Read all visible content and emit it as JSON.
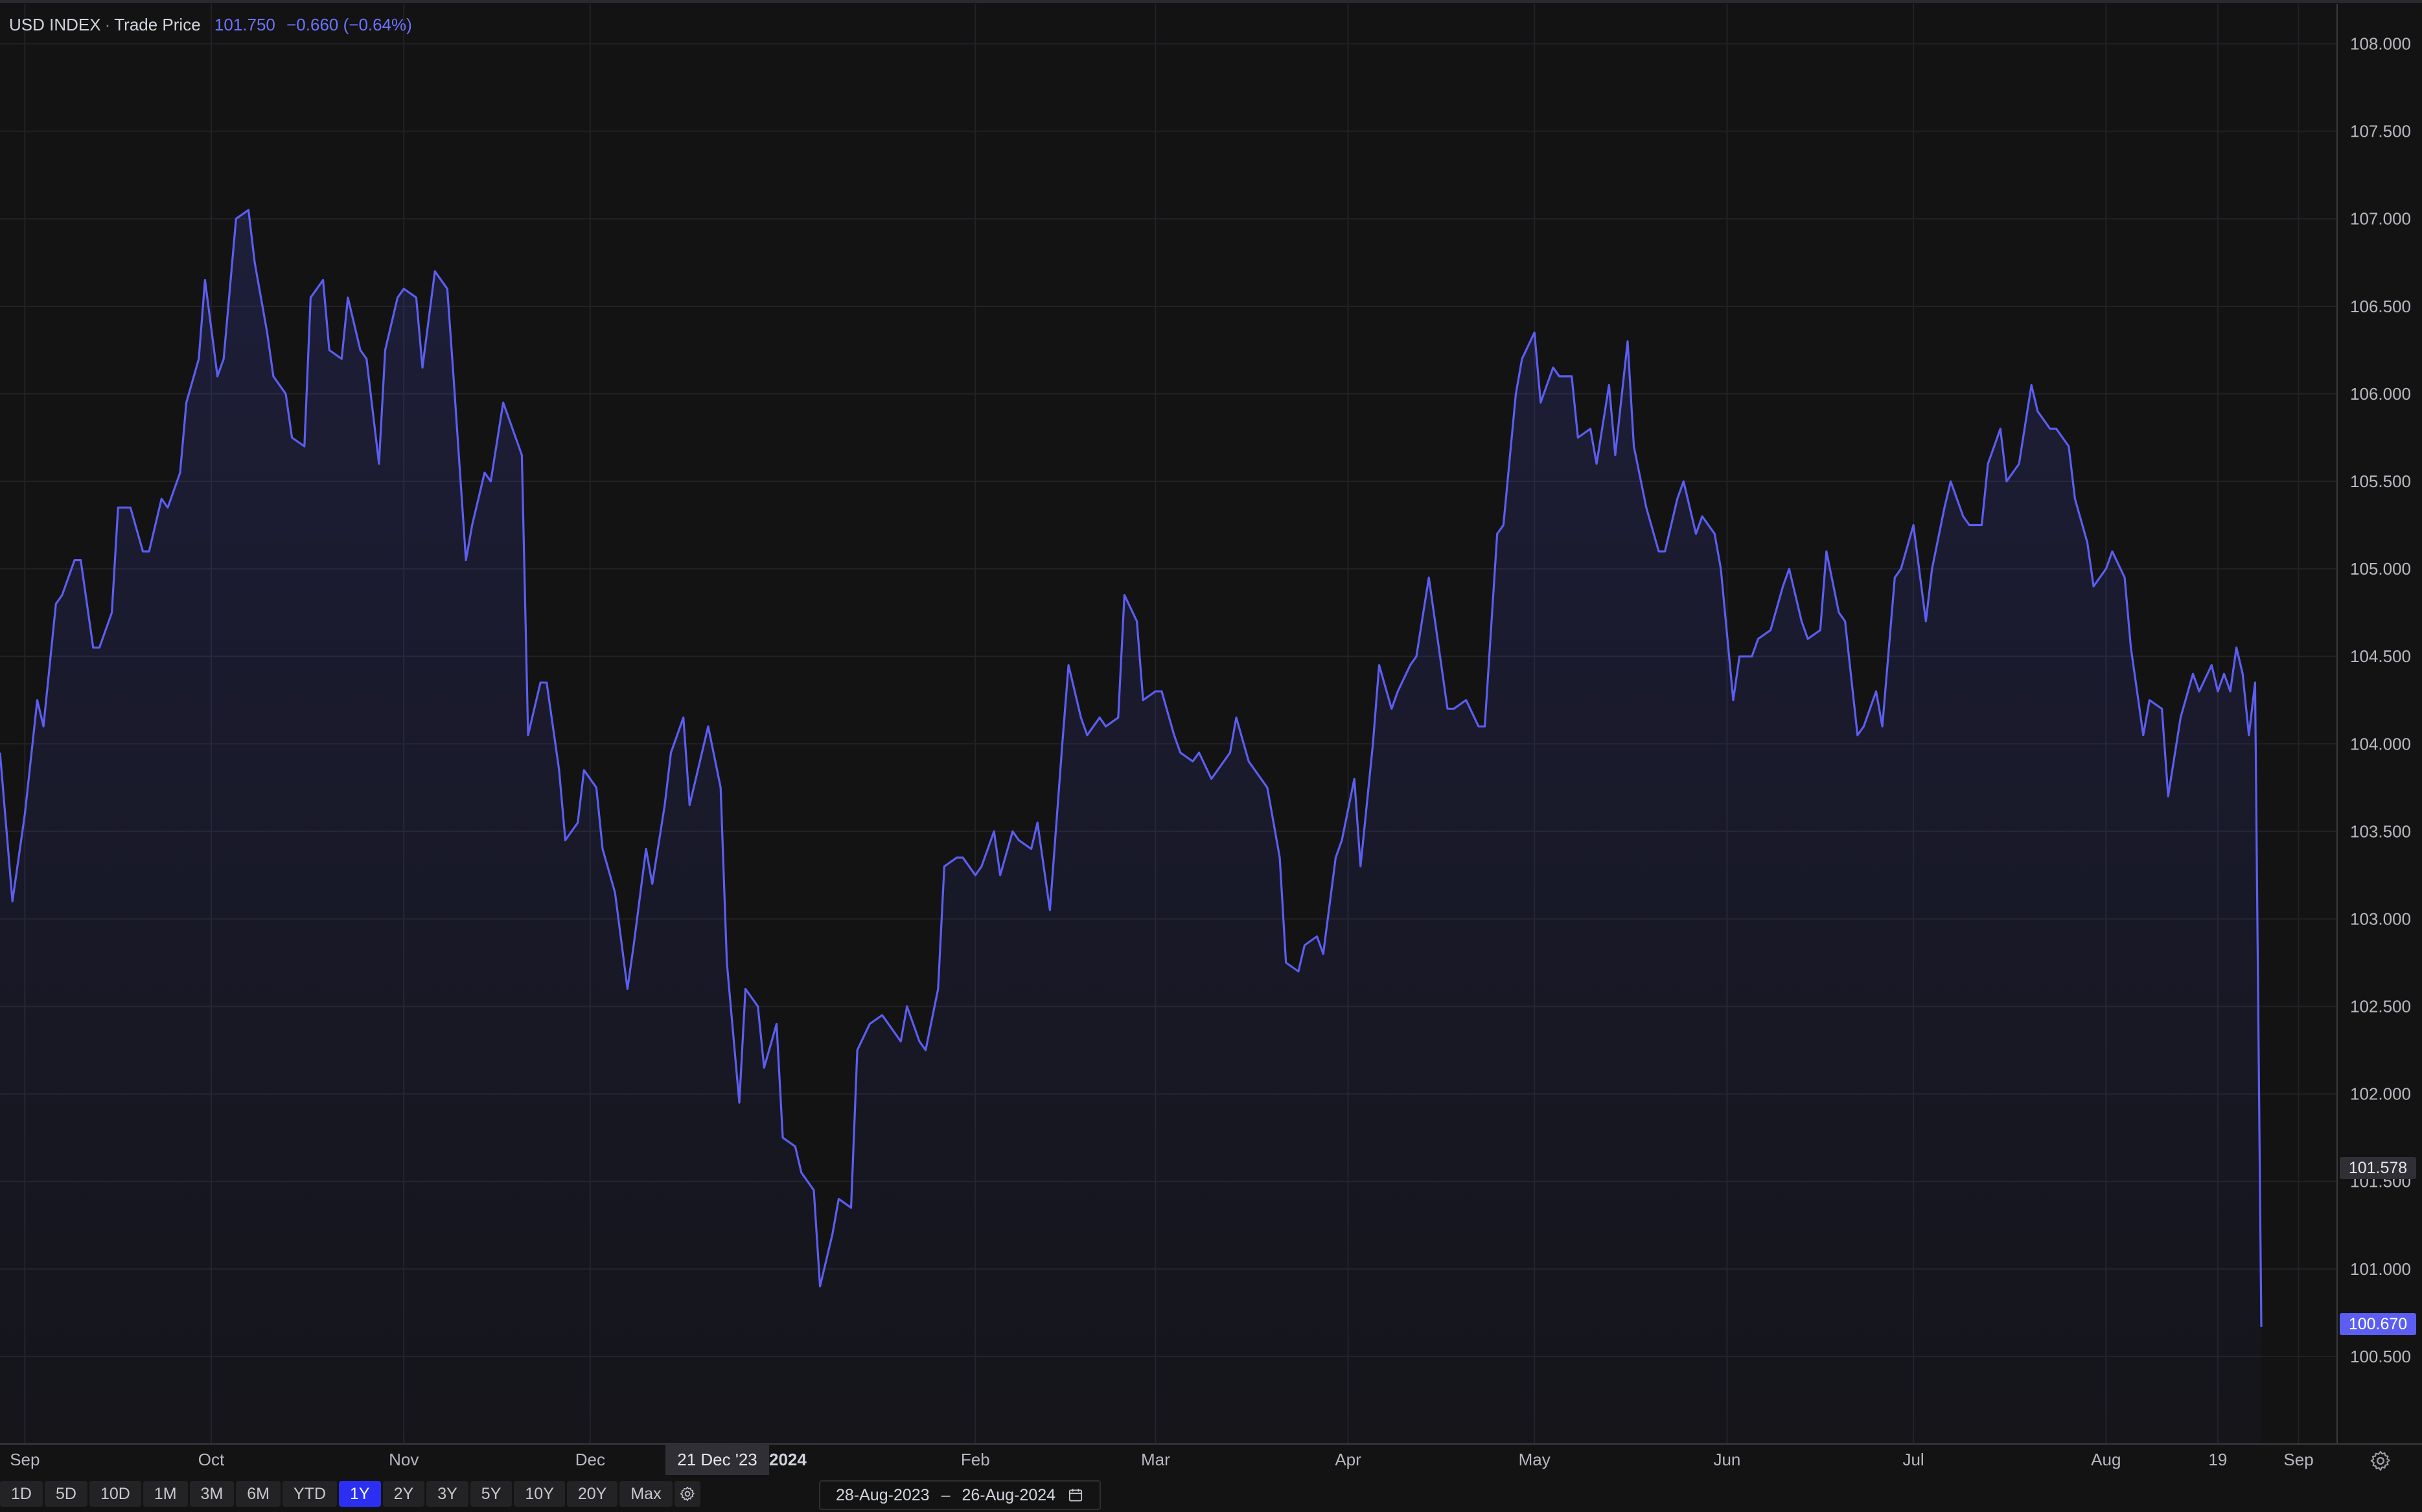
{
  "legend": {
    "symbol": "USD INDEX",
    "separator": "·",
    "series": "Trade Price",
    "price": "101.750",
    "change": "−0.660 (−0.64%)"
  },
  "colors": {
    "line": "#5b5ef0",
    "background": "#131314",
    "grid": "#25252a",
    "active_button": "#2b2ff2"
  },
  "crosshair": {
    "date_label": "21 Dec '23",
    "price_label": "101.578"
  },
  "last_price_label": "100.670",
  "year_label": "2024",
  "range_buttons": [
    "1D",
    "5D",
    "10D",
    "1M",
    "3M",
    "6M",
    "YTD",
    "1Y",
    "2Y",
    "3Y",
    "5Y",
    "10Y",
    "20Y",
    "Max"
  ],
  "active_range": "1Y",
  "date_range": {
    "start": "28-Aug-2023",
    "separator": "–",
    "end": "26-Aug-2024"
  },
  "chart_data": {
    "type": "area",
    "title": "",
    "x_range": [
      "2023-08-28",
      "2024-08-26"
    ],
    "y_range": [
      100.0,
      108.25
    ],
    "y_ticks": [
      100.5,
      101.0,
      101.5,
      102.0,
      102.5,
      103.0,
      103.5,
      104.0,
      104.5,
      105.0,
      105.5,
      106.0,
      106.5,
      107.0,
      107.5,
      108.0
    ],
    "y_tick_labels": [
      "100.500",
      "101.000",
      "101.500",
      "102.000",
      "102.500",
      "103.000",
      "103.500",
      "104.000",
      "104.500",
      "105.000",
      "105.500",
      "106.000",
      "106.500",
      "107.000",
      "107.500",
      "108.000"
    ],
    "x_ticks": [
      {
        "label": "Sep",
        "date": "2023-09-01"
      },
      {
        "label": "Oct",
        "date": "2023-10-01"
      },
      {
        "label": "Nov",
        "date": "2023-11-01"
      },
      {
        "label": "Dec",
        "date": "2023-12-01"
      },
      {
        "label": "Feb",
        "date": "2024-02-01"
      },
      {
        "label": "Mar",
        "date": "2024-03-01"
      },
      {
        "label": "Apr",
        "date": "2024-04-01"
      },
      {
        "label": "May",
        "date": "2024-05-01"
      },
      {
        "label": "Jun",
        "date": "2024-06-01"
      },
      {
        "label": "Jul",
        "date": "2024-07-01"
      },
      {
        "label": "Aug",
        "date": "2024-08-01"
      },
      {
        "label": "19",
        "date": "2024-08-19"
      },
      {
        "label": "Sep",
        "date": "2024-09-01"
      }
    ],
    "grid": true,
    "series": [
      {
        "points": [
          [
            "2023-08-28",
            103.95
          ],
          [
            "2023-08-30",
            103.1
          ],
          [
            "2023-09-01",
            103.6
          ],
          [
            "2023-09-03",
            104.25
          ],
          [
            "2023-09-04",
            104.1
          ],
          [
            "2023-09-06",
            104.8
          ],
          [
            "2023-09-07",
            104.85
          ],
          [
            "2023-09-09",
            105.05
          ],
          [
            "2023-09-10",
            105.05
          ],
          [
            "2023-09-12",
            104.55
          ],
          [
            "2023-09-13",
            104.55
          ],
          [
            "2023-09-15",
            104.75
          ],
          [
            "2023-09-16",
            105.35
          ],
          [
            "2023-09-18",
            105.35
          ],
          [
            "2023-09-20",
            105.1
          ],
          [
            "2023-09-21",
            105.1
          ],
          [
            "2023-09-23",
            105.4
          ],
          [
            "2023-09-24",
            105.35
          ],
          [
            "2023-09-26",
            105.55
          ],
          [
            "2023-09-27",
            105.95
          ],
          [
            "2023-09-29",
            106.2
          ],
          [
            "2023-09-30",
            106.65
          ],
          [
            "2023-10-02",
            106.1
          ],
          [
            "2023-10-03",
            106.2
          ],
          [
            "2023-10-05",
            107.0
          ],
          [
            "2023-10-07",
            107.05
          ],
          [
            "2023-10-08",
            106.75
          ],
          [
            "2023-10-10",
            106.35
          ],
          [
            "2023-10-11",
            106.1
          ],
          [
            "2023-10-13",
            106.0
          ],
          [
            "2023-10-14",
            105.75
          ],
          [
            "2023-10-16",
            105.7
          ],
          [
            "2023-10-17",
            106.55
          ],
          [
            "2023-10-19",
            106.65
          ],
          [
            "2023-10-20",
            106.25
          ],
          [
            "2023-10-22",
            106.2
          ],
          [
            "2023-10-23",
            106.55
          ],
          [
            "2023-10-25",
            106.25
          ],
          [
            "2023-10-26",
            106.2
          ],
          [
            "2023-10-28",
            105.6
          ],
          [
            "2023-10-29",
            106.25
          ],
          [
            "2023-10-31",
            106.55
          ],
          [
            "2023-11-01",
            106.6
          ],
          [
            "2023-11-03",
            106.55
          ],
          [
            "2023-11-04",
            106.15
          ],
          [
            "2023-11-06",
            106.7
          ],
          [
            "2023-11-08",
            106.6
          ],
          [
            "2023-11-09",
            106.1
          ],
          [
            "2023-11-11",
            105.05
          ],
          [
            "2023-11-12",
            105.25
          ],
          [
            "2023-11-14",
            105.55
          ],
          [
            "2023-11-15",
            105.5
          ],
          [
            "2023-11-17",
            105.95
          ],
          [
            "2023-11-18",
            105.85
          ],
          [
            "2023-11-20",
            105.65
          ],
          [
            "2023-11-21",
            104.05
          ],
          [
            "2023-11-23",
            104.35
          ],
          [
            "2023-11-24",
            104.35
          ],
          [
            "2023-11-26",
            103.85
          ],
          [
            "2023-11-27",
            103.45
          ],
          [
            "2023-11-29",
            103.55
          ],
          [
            "2023-11-30",
            103.85
          ],
          [
            "2023-12-02",
            103.75
          ],
          [
            "2023-12-03",
            103.4
          ],
          [
            "2023-12-05",
            103.15
          ],
          [
            "2023-12-07",
            102.6
          ],
          [
            "2023-12-08",
            102.85
          ],
          [
            "2023-12-10",
            103.4
          ],
          [
            "2023-12-11",
            103.2
          ],
          [
            "2023-12-13",
            103.65
          ],
          [
            "2023-12-14",
            103.95
          ],
          [
            "2023-12-16",
            104.15
          ],
          [
            "2023-12-17",
            103.65
          ],
          [
            "2023-12-19",
            103.95
          ],
          [
            "2023-12-20",
            104.1
          ],
          [
            "2023-12-22",
            103.75
          ],
          [
            "2023-12-23",
            102.75
          ],
          [
            "2023-12-25",
            101.95
          ],
          [
            "2023-12-26",
            102.6
          ],
          [
            "2023-12-28",
            102.5
          ],
          [
            "2023-12-29",
            102.15
          ],
          [
            "2023-12-31",
            102.4
          ],
          [
            "2024-01-01",
            101.75
          ],
          [
            "2024-01-03",
            101.7
          ],
          [
            "2024-01-04",
            101.55
          ],
          [
            "2024-01-06",
            101.45
          ],
          [
            "2024-01-07",
            100.9
          ],
          [
            "2024-01-09",
            101.2
          ],
          [
            "2024-01-10",
            101.4
          ],
          [
            "2024-01-12",
            101.35
          ],
          [
            "2024-01-13",
            102.25
          ],
          [
            "2024-01-15",
            102.4
          ],
          [
            "2024-01-17",
            102.45
          ],
          [
            "2024-01-18",
            102.4
          ],
          [
            "2024-01-20",
            102.3
          ],
          [
            "2024-01-21",
            102.5
          ],
          [
            "2024-01-23",
            102.3
          ],
          [
            "2024-01-24",
            102.25
          ],
          [
            "2024-01-26",
            102.6
          ],
          [
            "2024-01-27",
            103.3
          ],
          [
            "2024-01-29",
            103.35
          ],
          [
            "2024-01-30",
            103.35
          ],
          [
            "2024-02-01",
            103.25
          ],
          [
            "2024-02-02",
            103.3
          ],
          [
            "2024-02-04",
            103.5
          ],
          [
            "2024-02-05",
            103.25
          ],
          [
            "2024-02-07",
            103.5
          ],
          [
            "2024-02-08",
            103.45
          ],
          [
            "2024-02-10",
            103.4
          ],
          [
            "2024-02-11",
            103.55
          ],
          [
            "2024-02-13",
            103.05
          ],
          [
            "2024-02-15",
            104.0
          ],
          [
            "2024-02-16",
            104.45
          ],
          [
            "2024-02-18",
            104.15
          ],
          [
            "2024-02-19",
            104.05
          ],
          [
            "2024-02-21",
            104.15
          ],
          [
            "2024-02-22",
            104.1
          ],
          [
            "2024-02-24",
            104.15
          ],
          [
            "2024-02-25",
            104.85
          ],
          [
            "2024-02-27",
            104.7
          ],
          [
            "2024-02-28",
            104.25
          ],
          [
            "2024-03-01",
            104.3
          ],
          [
            "2024-03-02",
            104.3
          ],
          [
            "2024-03-04",
            104.05
          ],
          [
            "2024-03-05",
            103.95
          ],
          [
            "2024-03-07",
            103.9
          ],
          [
            "2024-03-08",
            103.95
          ],
          [
            "2024-03-10",
            103.8
          ],
          [
            "2024-03-11",
            103.85
          ],
          [
            "2024-03-13",
            103.95
          ],
          [
            "2024-03-14",
            104.15
          ],
          [
            "2024-03-16",
            103.9
          ],
          [
            "2024-03-18",
            103.8
          ],
          [
            "2024-03-19",
            103.75
          ],
          [
            "2024-03-21",
            103.35
          ],
          [
            "2024-03-22",
            102.75
          ],
          [
            "2024-03-24",
            102.7
          ],
          [
            "2024-03-25",
            102.85
          ],
          [
            "2024-03-27",
            102.9
          ],
          [
            "2024-03-28",
            102.8
          ],
          [
            "2024-03-30",
            103.35
          ],
          [
            "2024-03-31",
            103.45
          ],
          [
            "2024-04-02",
            103.8
          ],
          [
            "2024-04-03",
            103.3
          ],
          [
            "2024-04-05",
            104.0
          ],
          [
            "2024-04-06",
            104.45
          ],
          [
            "2024-04-08",
            104.2
          ],
          [
            "2024-04-09",
            104.3
          ],
          [
            "2024-04-11",
            104.45
          ],
          [
            "2024-04-12",
            104.5
          ],
          [
            "2024-04-14",
            104.95
          ],
          [
            "2024-04-15",
            104.7
          ],
          [
            "2024-04-17",
            104.2
          ],
          [
            "2024-04-18",
            104.2
          ],
          [
            "2024-04-20",
            104.25
          ],
          [
            "2024-04-22",
            104.1
          ],
          [
            "2024-04-23",
            104.1
          ],
          [
            "2024-04-25",
            105.2
          ],
          [
            "2024-04-26",
            105.25
          ],
          [
            "2024-04-28",
            106.0
          ],
          [
            "2024-04-29",
            106.2
          ],
          [
            "2024-05-01",
            106.35
          ],
          [
            "2024-05-02",
            105.95
          ],
          [
            "2024-05-04",
            106.15
          ],
          [
            "2024-05-05",
            106.1
          ],
          [
            "2024-05-07",
            106.1
          ],
          [
            "2024-05-08",
            105.75
          ],
          [
            "2024-05-10",
            105.8
          ],
          [
            "2024-05-11",
            105.6
          ],
          [
            "2024-05-13",
            106.05
          ],
          [
            "2024-05-14",
            105.65
          ],
          [
            "2024-05-16",
            106.3
          ],
          [
            "2024-05-17",
            105.7
          ],
          [
            "2024-05-19",
            105.35
          ],
          [
            "2024-05-21",
            105.1
          ],
          [
            "2024-05-22",
            105.1
          ],
          [
            "2024-05-24",
            105.4
          ],
          [
            "2024-05-25",
            105.5
          ],
          [
            "2024-05-27",
            105.2
          ],
          [
            "2024-05-28",
            105.3
          ],
          [
            "2024-05-30",
            105.2
          ],
          [
            "2024-05-31",
            105.0
          ],
          [
            "2024-06-02",
            104.25
          ],
          [
            "2024-06-03",
            104.5
          ],
          [
            "2024-06-05",
            104.5
          ],
          [
            "2024-06-06",
            104.6
          ],
          [
            "2024-06-08",
            104.65
          ],
          [
            "2024-06-10",
            104.9
          ],
          [
            "2024-06-11",
            105.0
          ],
          [
            "2024-06-13",
            104.7
          ],
          [
            "2024-06-14",
            104.6
          ],
          [
            "2024-06-16",
            104.65
          ],
          [
            "2024-06-17",
            105.1
          ],
          [
            "2024-06-19",
            104.75
          ],
          [
            "2024-06-20",
            104.7
          ],
          [
            "2024-06-22",
            104.05
          ],
          [
            "2024-06-23",
            104.1
          ],
          [
            "2024-06-25",
            104.3
          ],
          [
            "2024-06-26",
            104.1
          ],
          [
            "2024-06-28",
            104.95
          ],
          [
            "2024-06-29",
            105.0
          ],
          [
            "2024-07-01",
            105.25
          ],
          [
            "2024-07-03",
            104.7
          ],
          [
            "2024-07-04",
            105.0
          ],
          [
            "2024-07-06",
            105.35
          ],
          [
            "2024-07-07",
            105.5
          ],
          [
            "2024-07-09",
            105.3
          ],
          [
            "2024-07-10",
            105.25
          ],
          [
            "2024-07-12",
            105.25
          ],
          [
            "2024-07-13",
            105.6
          ],
          [
            "2024-07-15",
            105.8
          ],
          [
            "2024-07-16",
            105.5
          ],
          [
            "2024-07-18",
            105.6
          ],
          [
            "2024-07-20",
            106.05
          ],
          [
            "2024-07-21",
            105.9
          ],
          [
            "2024-07-23",
            105.8
          ],
          [
            "2024-07-24",
            105.8
          ],
          [
            "2024-07-26",
            105.7
          ],
          [
            "2024-07-27",
            105.4
          ],
          [
            "2024-07-29",
            105.15
          ],
          [
            "2024-07-30",
            104.9
          ],
          [
            "2024-08-01",
            105.0
          ],
          [
            "2024-08-02",
            105.1
          ],
          [
            "2024-08-04",
            104.95
          ],
          [
            "2024-08-05",
            104.55
          ],
          [
            "2024-08-07",
            104.05
          ],
          [
            "2024-08-08",
            104.25
          ],
          [
            "2024-08-10",
            104.2
          ],
          [
            "2024-08-11",
            103.7
          ],
          [
            "2024-08-13",
            104.15
          ],
          [
            "2024-08-15",
            104.4
          ],
          [
            "2024-08-16",
            104.3
          ],
          [
            "2024-08-18",
            104.45
          ],
          [
            "2024-08-19",
            104.3
          ],
          [
            "2024-08-20",
            104.4
          ],
          [
            "2024-08-21",
            104.3
          ],
          [
            "2024-08-22",
            104.55
          ],
          [
            "2024-08-23",
            104.4
          ],
          [
            "2024-08-24",
            104.05
          ],
          [
            "2024-08-25",
            104.35
          ],
          [
            "2024-08-26",
            100.67
          ]
        ]
      }
    ]
  }
}
